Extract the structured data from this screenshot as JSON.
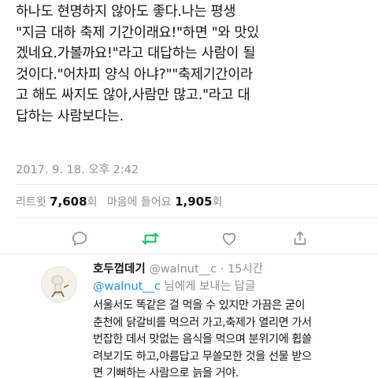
{
  "tweet": {
    "lines": [
      "하나도 현명하지 않아도 좋다.나는 평생",
      "\"지금 대하 축제 기간이래요!\"하면 \"와 맛있",
      "겠네요.가볼까요!\"라고 대답하는 사람이 될",
      "것이다.\"어차피 양식 아냐?\"\"축제기간이라",
      "고 해도 싸지도 않아,사람만 많고.\"라고 대",
      "답하는 사람보다는."
    ],
    "timestamp": "2017. 9. 18. 오후 2:42",
    "stats": {
      "retweet_label": "리트윗",
      "retweet_count": "7,608",
      "retweet_unit": "회",
      "like_label": "마음에 들어요",
      "like_count": "1,905",
      "like_unit": "회"
    }
  },
  "actions": {
    "reply_icon": "comment-icon",
    "retweet_icon": "retweet-icon",
    "like_icon": "heart-icon",
    "share_icon": "share-icon",
    "retweet_color": "#17bf63"
  },
  "reply": {
    "name": "호두껍데기",
    "handle": "@walnut__c",
    "time": "· 15시간",
    "reply_to_mention": "@walnut__c",
    "reply_to_suffix": " 님에게 보내는 답글",
    "lines": [
      "서울서도 똑같은 걸 먹을 수 있지만 가끔은 굳이",
      "춘천에 닭갈비를 먹으러 가고,축제가 열리면 가서",
      "번잡한 데서 맛없는 음식을 먹으며 분위기에 휩쓸",
      "려보기도 하고,아름답고 무쓸모한 것을 선물 받으",
      "면 기뻐하는 사람으로 늙을 거야."
    ]
  },
  "colors": {
    "text": "#14171a",
    "secondary": "#8a9199",
    "link": "#1b95e0",
    "retweet_green": "#17bf63"
  }
}
